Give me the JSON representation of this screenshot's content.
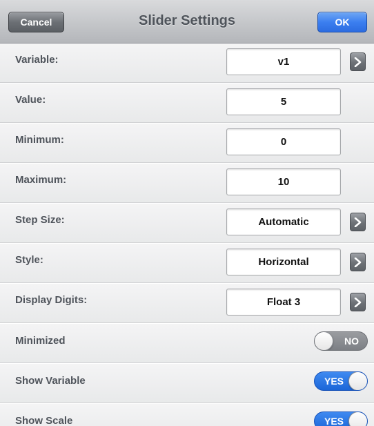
{
  "header": {
    "title": "Slider Settings",
    "cancel_label": "Cancel",
    "ok_label": "OK"
  },
  "rows": [
    {
      "label": "Variable:",
      "value": "v1",
      "has_arrow": true
    },
    {
      "label": "Value:",
      "value": "5",
      "has_arrow": false
    },
    {
      "label": "Minimum:",
      "value": "0",
      "has_arrow": false
    },
    {
      "label": "Maximum:",
      "value": "10",
      "has_arrow": false
    },
    {
      "label": "Step Size:",
      "value": "Automatic",
      "has_arrow": true
    },
    {
      "label": "Style:",
      "value": "Horizontal",
      "has_arrow": true
    },
    {
      "label": "Display Digits:",
      "value": "Float 3",
      "has_arrow": true
    }
  ],
  "toggles": [
    {
      "label": "Minimized",
      "state": "NO",
      "on": false
    },
    {
      "label": "Show Variable",
      "state": "YES",
      "on": true
    },
    {
      "label": "Show Scale",
      "state": "YES",
      "on": true
    }
  ],
  "icons": {
    "arrow": "chevron-right-icon"
  },
  "colors": {
    "ok_blue": "#3c7ff0",
    "toggle_on": "#1b66d8",
    "toggle_off": "#7c7f84",
    "label_text": "#4f545b"
  }
}
